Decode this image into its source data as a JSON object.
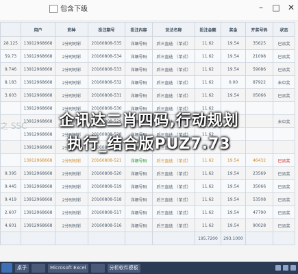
{
  "window": {
    "checkbox_label": "包含下级"
  },
  "table": {
    "headers": [
      "",
      "用户",
      "彩种",
      "投注期号",
      "投注内容",
      "玩法名称",
      "投注金额",
      "奖金",
      "开奖号码",
      "状态"
    ],
    "rows": [
      {
        "amt": "28.125",
        "user": "13912968668",
        "lottery": "2分时时彩",
        "issue": "20160808-535",
        "content": "详细号码",
        "play": "后三直选 （单式）",
        "bet": "11.62",
        "prize": "19.54",
        "open": "35625",
        "status": "已派奖",
        "status_type": "red",
        "hl": false
      },
      {
        "amt": "59.73",
        "user": "13912968668",
        "lottery": "2分时时彩",
        "issue": "20160808-534",
        "content": "详细号码",
        "play": "后三直选 （单式）",
        "bet": "11.62",
        "prize": "19.54",
        "open": "21098",
        "status": "已派奖",
        "status_type": "red",
        "hl": false
      },
      {
        "amt": "9.746",
        "user": "13912968668",
        "lottery": "2分时时彩",
        "issue": "20160808-533",
        "content": "详细号码",
        "play": "后三直选 （单式）",
        "bet": "11.62",
        "prize": "19.54",
        "open": "59086",
        "status": "已派奖",
        "status_type": "red",
        "hl": false
      },
      {
        "amt": "8.183",
        "user": "13912968668",
        "lottery": "2分时时彩",
        "issue": "20160808-532",
        "content": "详细号码",
        "play": "后三直选 （单式）",
        "bet": "11.62",
        "prize": "0.00",
        "open": "87922",
        "status": "未中奖",
        "status_type": "green",
        "hl": false
      },
      {
        "amt": "3.603",
        "user": "13912968668",
        "lottery": "2分时时彩",
        "issue": "20160808-531",
        "content": "详细号码",
        "play": "后三直选 （单式）",
        "bet": "11.62",
        "prize": "19.54",
        "open": "05066",
        "status": "已派奖",
        "status_type": "red",
        "hl": false
      },
      {
        "amt": "",
        "user": "13912968668",
        "lottery": "2分时时彩",
        "issue": "20160808-530",
        "content": "详细号码",
        "play": "后三直选 （单式）",
        "bet": "11.62",
        "prize": "",
        "open": "",
        "status": "",
        "status_type": "red",
        "hl": false
      },
      {
        "amt": "",
        "user": "13912968668",
        "lottery": "2分时时彩",
        "issue": "20160808-529",
        "content": "详细号码",
        "play": "后三直选 （单式）",
        "bet": "11.62",
        "prize": "",
        "open": "",
        "status": "未中奖",
        "status_type": "green",
        "hl": false
      },
      {
        "amt": "",
        "user": "13912968668",
        "lottery": "2分时时彩",
        "issue": "20160808-528",
        "content": "详细号码",
        "play": "后三直选 （单式）",
        "bet": "11.62",
        "prize": "",
        "open": "",
        "status": "",
        "status_type": "red",
        "hl": false
      },
      {
        "amt": "",
        "user": "13912968668",
        "lottery": "2分时时彩",
        "issue": "20160808-522",
        "content": "详细号码",
        "play": "后三直选 （单式）",
        "bet": "11.62",
        "prize": "",
        "open": "",
        "status": "",
        "status_type": "red",
        "hl": false
      },
      {
        "amt": "",
        "user": "13912968668",
        "lottery": "2分时时彩",
        "issue": "20160808-521",
        "content": "详细号码",
        "play": "后三直选 （单式）",
        "bet": "11.62",
        "prize": "19.54",
        "open": "46432",
        "status": "已派奖",
        "status_type": "red",
        "hl": true
      },
      {
        "amt": "9.395",
        "user": "13912968668",
        "lottery": "2分时时彩",
        "issue": "20160808-520",
        "content": "详细号码",
        "play": "后三直选 （单式）",
        "bet": "11.62",
        "prize": "19.54",
        "open": "23569",
        "status": "已派奖",
        "status_type": "red",
        "hl": false
      },
      {
        "amt": "9.445",
        "user": "13912968668",
        "lottery": "2分时时彩",
        "issue": "20160808-519",
        "content": "详细号码",
        "play": "后三直选 （单式）",
        "bet": "11.62",
        "prize": "19.54",
        "open": "35066",
        "status": "已派奖",
        "status_type": "red",
        "hl": false
      },
      {
        "amt": "9.419",
        "user": "13912968668",
        "lottery": "2分时时彩",
        "issue": "20160808-518",
        "content": "详细号码",
        "play": "后三直选 （单式）",
        "bet": "11.62",
        "prize": "19.54",
        "open": "53508",
        "status": "已派奖",
        "status_type": "red",
        "hl": false
      },
      {
        "amt": "2.607",
        "user": "13912968668",
        "lottery": "2分时时彩",
        "issue": "20160808-517",
        "content": "详细号码",
        "play": "后三直选 （单式）",
        "bet": "11.62",
        "prize": "19.54",
        "open": "47790",
        "status": "已派奖",
        "status_type": "red",
        "hl": false
      },
      {
        "amt": "4.601",
        "user": "13912968668",
        "lottery": "2分时时彩",
        "issue": "20160808-516",
        "content": "详细号码",
        "play": "后三直选 （单式）",
        "bet": "11.62",
        "prize": "19.54",
        "open": "90028",
        "status": "已派奖",
        "status_type": "red",
        "hl": false
      }
    ],
    "totals": {
      "bet": "195.7200",
      "prize": "293.1000"
    }
  },
  "overlay": {
    "line1": "企讯达二肖四码,行动规划",
    "line2": "执行_结合版PUZ7.73",
    "ghost": "之 SSC"
  },
  "taskbar": {
    "items": [
      "桌子",
      "",
      "Microsoft Excel",
      "",
      "分析软件模板"
    ]
  },
  "colors": {
    "status_red": "#e02020",
    "status_green": "#2a8a2a",
    "detail_green": "#2f9a2f",
    "overlay_text": "#ffffff"
  }
}
